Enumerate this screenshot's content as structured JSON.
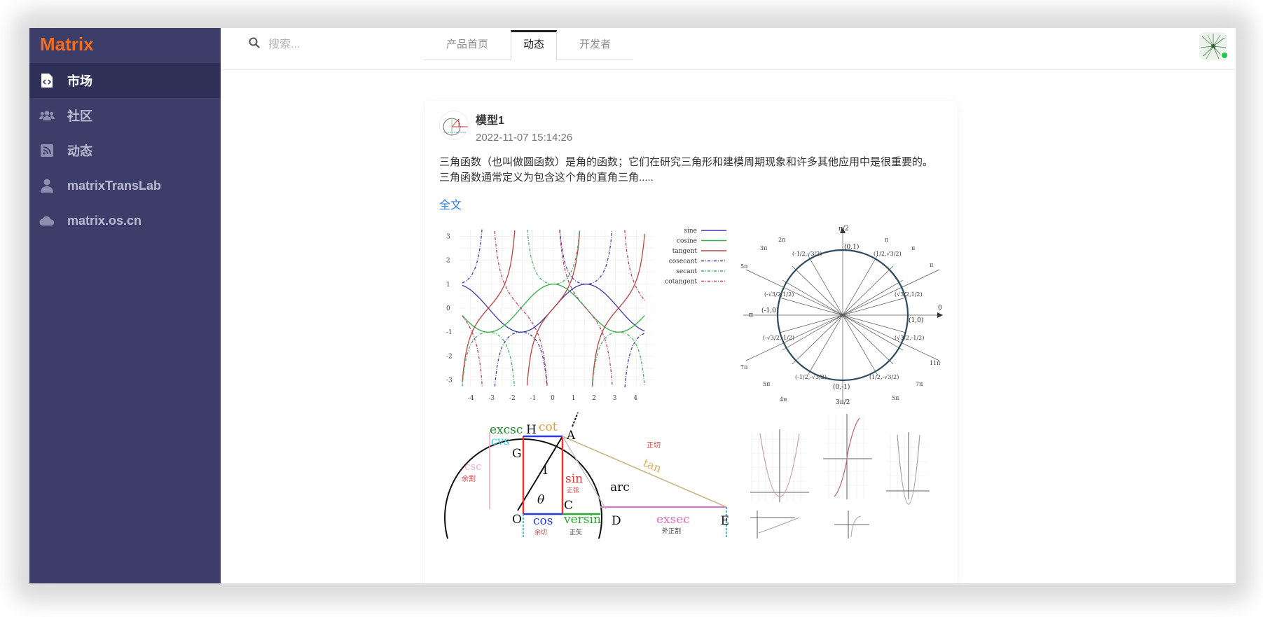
{
  "app": {
    "logo": "Matrix"
  },
  "sidebar": {
    "items": [
      {
        "label": "市场",
        "icon": "code-file-icon",
        "active": true
      },
      {
        "label": "社区",
        "icon": "users-icon",
        "active": false
      },
      {
        "label": "动态",
        "icon": "rss-icon",
        "active": false
      },
      {
        "label": "matrixTransLab",
        "icon": "user-icon",
        "active": false
      },
      {
        "label": "matrix.os.cn",
        "icon": "cloud-icon",
        "active": false
      }
    ]
  },
  "header": {
    "search_placeholder": "搜索...",
    "tabs": [
      {
        "label": "产品首页",
        "active": false
      },
      {
        "label": "动态",
        "active": true
      },
      {
        "label": "开发者",
        "active": false
      }
    ]
  },
  "post": {
    "author": "模型1",
    "time": "2022-11-07 15:14:26",
    "text": "三角函数（也叫做圆函数）是角的函数；它们在研究三角形和建模周期现象和许多其他应用中是很重要的。 三角函数通常定义为包含这个角的直角三角.....",
    "more_label": "全文",
    "figures": {
      "plot_legend": [
        "sine",
        "cosine",
        "tangent",
        "cosecant",
        "secant",
        "cotangent"
      ],
      "plot_y_ticks": [
        "3",
        "2",
        "1",
        "0",
        "-1",
        "-2",
        "-3"
      ],
      "plot_x_ticks": [
        "-4",
        "-3",
        "-2",
        "-1",
        "0",
        "1",
        "2",
        "3",
        "4"
      ],
      "circle_points": [
        "(0,1)",
        "(-1,0)",
        "(1,0)",
        "(0,-1)"
      ],
      "circle_angles": [
        "π",
        "0",
        "2π",
        "π/2",
        "3π/2"
      ],
      "geo_labels": [
        "excsc",
        "H",
        "cot",
        "A",
        "cvs",
        "G",
        "csc",
        "1",
        "sin",
        "θ",
        "arc",
        "O",
        "C",
        "cos",
        "versin",
        "D",
        "exsec",
        "E",
        "tan"
      ],
      "geo_cn_labels": [
        "正切",
        "余割",
        "正弦",
        "余切",
        "正矢",
        "外正割"
      ]
    }
  },
  "colors": {
    "sidebar_bg": "#3c3d68",
    "accent": "#f26c1e",
    "link": "#2c7be5"
  }
}
